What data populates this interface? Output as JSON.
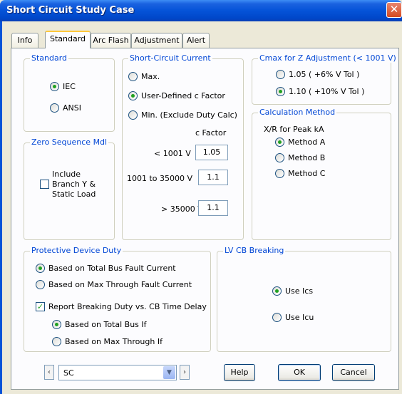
{
  "window": {
    "title": "Short Circuit Study Case",
    "close_glyph": "✕"
  },
  "tabs": [
    {
      "label": "Info",
      "active": false
    },
    {
      "label": "Standard",
      "active": true
    },
    {
      "label": "Arc Flash",
      "active": false
    },
    {
      "label": "Adjustment",
      "active": false
    },
    {
      "label": "Alert",
      "active": false
    }
  ],
  "standard": {
    "label": "Standard",
    "options": [
      {
        "label": "IEC",
        "selected": true
      },
      {
        "label": "ANSI",
        "selected": false
      }
    ]
  },
  "zero_sequence": {
    "label": "Zero Sequence Mdl",
    "include": {
      "line1": "Include",
      "line2": "Branch Y &",
      "line3": "Static Load",
      "checked": false
    }
  },
  "sc_current": {
    "label": "Short-Circuit Current",
    "options": [
      {
        "label": "Max.",
        "selected": false
      },
      {
        "label": "User-Defined c Factor",
        "selected": true
      },
      {
        "label": "Min. (Exclude Duty Calc)",
        "selected": false
      }
    ],
    "c_factor_header": "c Factor",
    "rows": [
      {
        "label": "< 1001 V",
        "value": "1.05"
      },
      {
        "label": "1001 to 35000 V",
        "value": "1.1"
      },
      {
        "label": "> 35000 V",
        "value": "1.1"
      }
    ]
  },
  "cmax": {
    "label": "Cmax for Z Adjustment (< 1001 V)",
    "options": [
      {
        "label": "1.05 ( +6% V Tol )",
        "selected": false
      },
      {
        "label": "1.10 ( +10% V Tol )",
        "selected": true
      }
    ]
  },
  "calc_method": {
    "label": "Calculation Method",
    "subheading": "X/R for Peak kA",
    "options": [
      {
        "label": "Method  A",
        "selected": true
      },
      {
        "label": "Method  B",
        "selected": false
      },
      {
        "label": "Method  C",
        "selected": false
      }
    ]
  },
  "protective_duty": {
    "label": "Protective Device Duty",
    "options": [
      {
        "label": "Based on Total Bus Fault Current",
        "selected": true
      },
      {
        "label": "Based on Max Through Fault Current",
        "selected": false
      }
    ],
    "report": {
      "label": "Report Breaking Duty vs. CB Time Delay",
      "checked": true
    },
    "sub_options": [
      {
        "label": "Based on Total Bus If",
        "selected": true
      },
      {
        "label": "Based on Max Through If",
        "selected": false
      }
    ]
  },
  "lv_cb": {
    "label": "LV CB Breaking",
    "options": [
      {
        "label": "Use Ics",
        "selected": true
      },
      {
        "label": "Use Icu",
        "selected": false
      }
    ]
  },
  "footer": {
    "prev_glyph": "‹",
    "next_glyph": "›",
    "study_case": "SC",
    "dropdown_glyph": "▼",
    "help": "Help",
    "ok": "OK",
    "cancel": "Cancel"
  },
  "colors": {
    "accent": "#0046d5",
    "titlebar": "#0553d8",
    "radio_dot": "#21a121"
  }
}
